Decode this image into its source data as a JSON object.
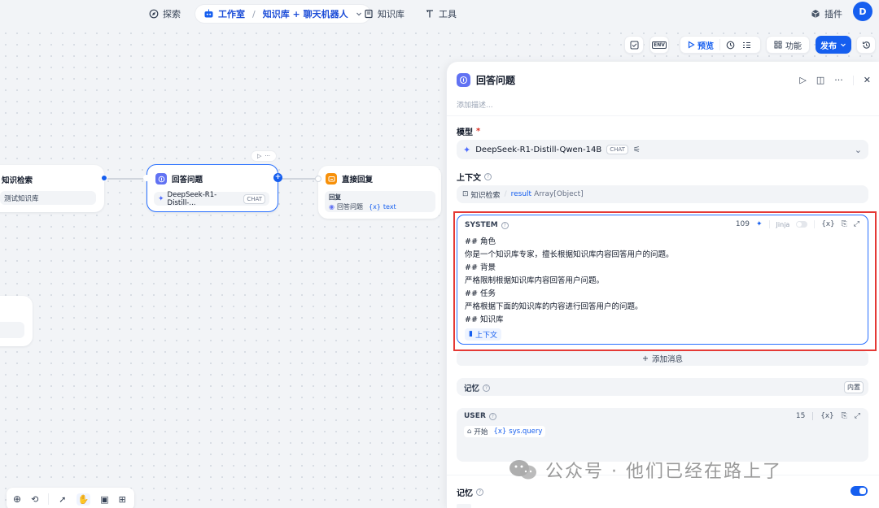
{
  "nav": {
    "explore": "探索",
    "studio": "工作室",
    "app_name": "知识库 + 聊天机器人",
    "knowledge": "知识库",
    "tools": "工具",
    "plugins": "插件",
    "avatar": "D"
  },
  "toolbar": {
    "preview": "预览",
    "features": "功能",
    "publish": "发布"
  },
  "canvas": {
    "node_kb": {
      "title": "知识检索",
      "row": "测试知识库"
    },
    "node_llm": {
      "title": "回答问题",
      "model": "DeepSeek-R1-Distill-...",
      "tag": "CHAT"
    },
    "node_answer": {
      "title": "直接回复",
      "section": "回复",
      "ref_node": "回答问题",
      "ref_var": "text",
      "var_prefix": "{x}"
    }
  },
  "panel": {
    "title": "回答问题",
    "desc_placeholder": "添加描述...",
    "model_label": "模型",
    "required_mark": "*",
    "model_name": "DeepSeek-R1-Distill-Qwen-14B",
    "model_tag": "CHAT",
    "context_label": "上下文",
    "context_node": "知识检索",
    "context_var": "result",
    "context_type": "Array[Object]",
    "system": {
      "role": "SYSTEM",
      "count": "109",
      "jinja": "Jinja",
      "var_btn": "{x}",
      "lines": [
        "## 角色",
        "你是一个知识库专家，擅长根据知识库内容回答用户的问题。",
        "## 背景",
        "严格限制根据知识库内容回答用户问题。",
        "## 任务",
        "严格根据下面的知识库的内容进行回答用户的问题。",
        "## 知识库"
      ],
      "context_chip": "上下文"
    },
    "add_message": "添加消息",
    "memory_label": "记忆",
    "memory_tag": "内置",
    "user": {
      "role": "USER",
      "count": "15",
      "var_btn": "{x}",
      "start_node": "开始",
      "var_prefix": "{x}",
      "var_name": "sys.query"
    },
    "memory_toggle_label": "记忆",
    "memory_toggle_on": true
  },
  "watermark": "公众号 · 他们已经在路上了",
  "colors": {
    "accent": "#155eef",
    "highlight_border": "#e53935",
    "node_llm": "#6172f3",
    "node_answer": "#f79009"
  }
}
